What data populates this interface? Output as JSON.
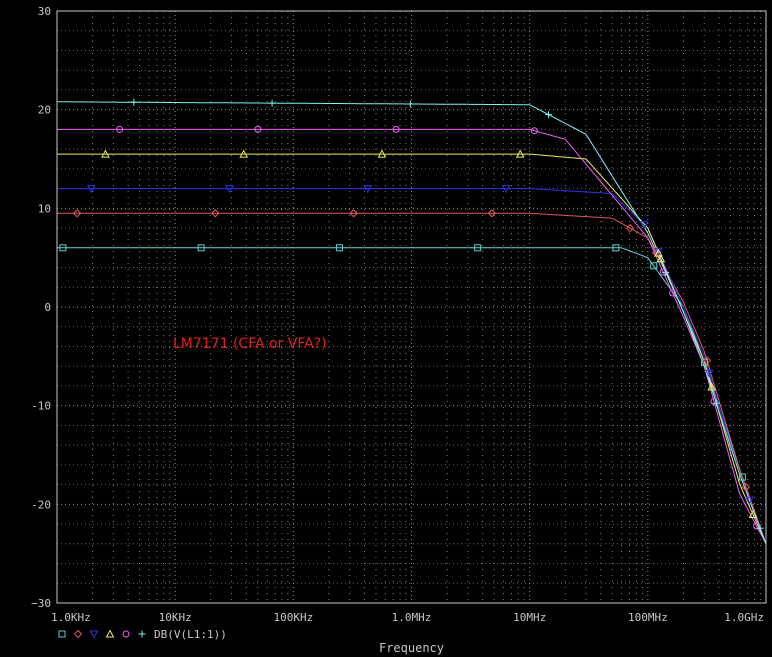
{
  "chart_data": {
    "type": "line",
    "x_scale": "log",
    "xlim": [
      1000,
      1000000000
    ],
    "ylim": [
      -30,
      30
    ],
    "xlabel": "Frequency",
    "ylabel": "",
    "x_ticks": [
      {
        "value": 1000,
        "label": "1.0KHz"
      },
      {
        "value": 10000,
        "label": "10KHz"
      },
      {
        "value": 100000,
        "label": "100KHz"
      },
      {
        "value": 1000000,
        "label": "1.0MHz"
      },
      {
        "value": 10000000,
        "label": "10MHz"
      },
      {
        "value": 100000000,
        "label": "100MHz"
      },
      {
        "value": 1000000000,
        "label": "1.0GHz"
      }
    ],
    "y_ticks": [
      {
        "value": 30,
        "label": "30"
      },
      {
        "value": 20,
        "label": "20"
      },
      {
        "value": 10,
        "label": "10"
      },
      {
        "value": 0,
        "label": "0"
      },
      {
        "value": -10,
        "label": "-10"
      },
      {
        "value": -20,
        "label": "-20"
      },
      {
        "value": -30,
        "label": "−30"
      }
    ],
    "grid": true,
    "annotation": "LM7171 (CFA or VFA?)",
    "legend_label": "DB(V(L1:1))",
    "colors": {
      "background": "#000000",
      "grid": "#a0a0a0",
      "text": "#c8c8c8",
      "annotation": "#e02020"
    },
    "series": [
      {
        "marker": "square",
        "color": "#5fd0d0",
        "x": [
          1000,
          10000000,
          60000000,
          100000000,
          200000000,
          300000000,
          600000000,
          1000000000
        ],
        "y": [
          6,
          6,
          6,
          5,
          0,
          -5.5,
          -16.5,
          -24
        ]
      },
      {
        "marker": "diamond",
        "color": "#e05a5a",
        "x": [
          1000,
          10000000,
          50000000,
          100000000,
          200000000,
          300000000,
          600000000,
          1000000000
        ],
        "y": [
          9.5,
          9.5,
          9,
          7,
          0.5,
          -4.5,
          -16.5,
          -24
        ]
      },
      {
        "marker": "triangle-down",
        "color": "#3030e8",
        "x": [
          1000,
          10000000,
          50000000,
          100000000,
          200000000,
          300000000,
          600000000,
          1000000000
        ],
        "y": [
          12,
          12,
          11.5,
          8,
          0,
          -5,
          -17,
          -24
        ]
      },
      {
        "marker": "triangle-up",
        "color": "#f0f060",
        "x": [
          1000,
          10000000,
          30000000,
          100000000,
          200000000,
          300000000,
          600000000,
          1000000000
        ],
        "y": [
          15.5,
          15.5,
          15,
          8,
          -0.5,
          -5.5,
          -18,
          -24
        ]
      },
      {
        "marker": "circle",
        "color": "#f060f0",
        "x": [
          1000,
          10000000,
          20000000,
          100000000,
          200000000,
          300000000,
          600000000,
          1000000000
        ],
        "y": [
          18,
          18,
          17,
          7,
          -1,
          -6,
          -19,
          -24
        ]
      },
      {
        "marker": "plus",
        "color": "#80f0f0",
        "x": [
          1000,
          10000000,
          30000000,
          100000000,
          200000000,
          300000000,
          600000000,
          1000000000
        ],
        "y": [
          20.8,
          20.5,
          17.5,
          7.5,
          -0.5,
          -6,
          -17,
          -24
        ]
      }
    ]
  }
}
